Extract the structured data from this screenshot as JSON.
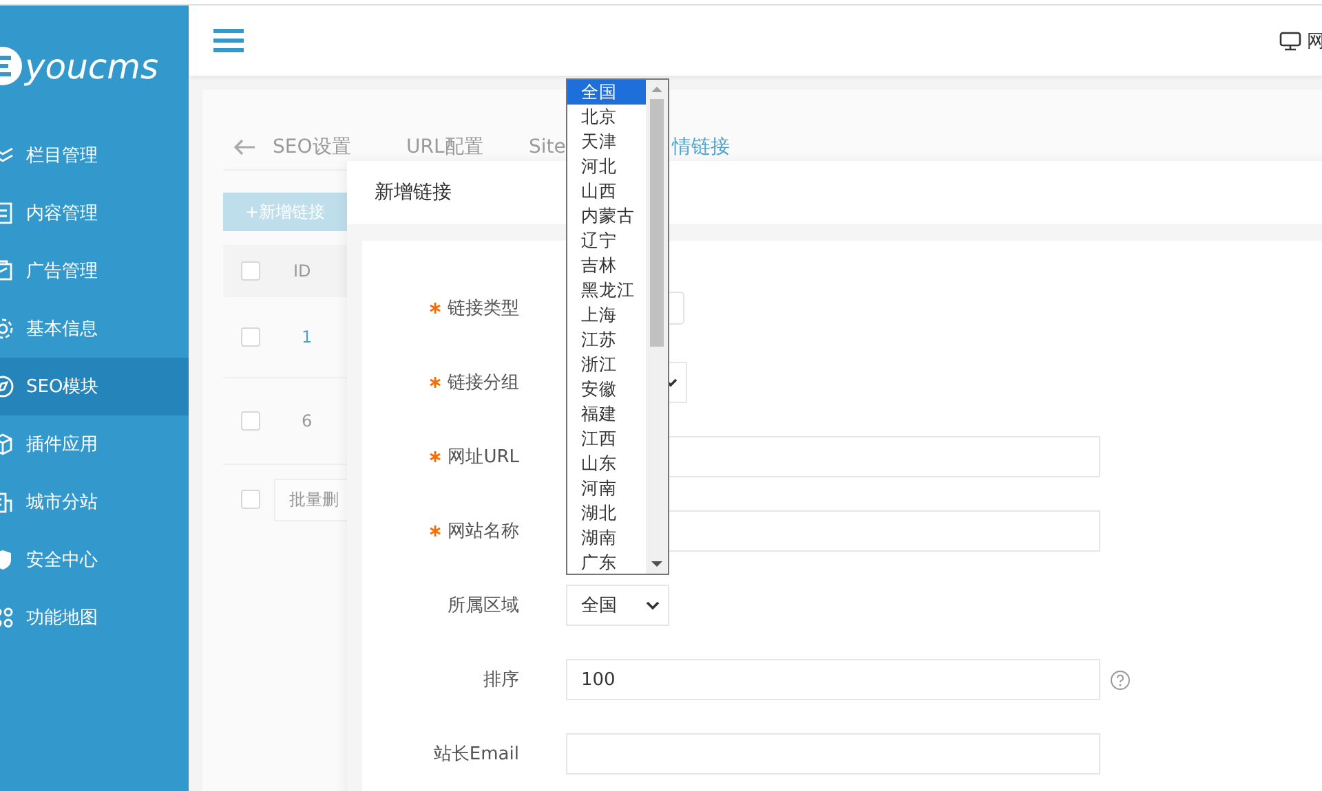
{
  "sidebar": {
    "logo": {
      "text": "youcms"
    },
    "items": [
      {
        "label": "栏目管理",
        "selected": false
      },
      {
        "label": "内容管理",
        "selected": false
      },
      {
        "label": "广告管理",
        "selected": false
      },
      {
        "label": "基本信息",
        "selected": false
      },
      {
        "label": "SEO模块",
        "selected": true
      },
      {
        "label": "插件应用",
        "selected": false
      },
      {
        "label": "城市分站",
        "selected": false
      },
      {
        "label": "安全中心",
        "selected": false
      },
      {
        "label": "功能地图",
        "selected": false
      }
    ]
  },
  "header": {
    "right_text": "网"
  },
  "tabs": [
    {
      "label": "SEO设置",
      "selected": false
    },
    {
      "label": "URL配置",
      "selected": false
    },
    {
      "label": "Site",
      "selected": false
    },
    {
      "label": "情链接",
      "selected": true
    }
  ],
  "table": {
    "add_button": "+新增链接",
    "header_checked": false,
    "columns": [
      "ID"
    ],
    "rows": [
      {
        "id": "1",
        "checked": false
      },
      {
        "id": "6",
        "checked": false
      }
    ],
    "bulk_checked": false,
    "bulk_button": "批量删"
  },
  "modal": {
    "title": "新增链接",
    "fields": [
      {
        "label": "链接类型",
        "required": true,
        "kind": "box"
      },
      {
        "label": "链接分组",
        "required": true,
        "kind": "select"
      },
      {
        "label": "网址URL",
        "required": true,
        "kind": "input"
      },
      {
        "label": "网站名称",
        "required": true,
        "kind": "input"
      },
      {
        "label": "所属区域",
        "required": false,
        "kind": "select",
        "value": "全国"
      },
      {
        "label": "排序",
        "required": false,
        "kind": "input",
        "value": "100",
        "help": true
      },
      {
        "label": "站长Email",
        "required": false,
        "kind": "input"
      }
    ]
  },
  "dropdown": {
    "options": [
      {
        "label": "全国",
        "selected": true
      },
      {
        "label": "北京",
        "selected": false
      },
      {
        "label": "天津",
        "selected": false
      },
      {
        "label": "河北",
        "selected": false
      },
      {
        "label": "山西",
        "selected": false
      },
      {
        "label": "内蒙古",
        "selected": false
      },
      {
        "label": "辽宁",
        "selected": false
      },
      {
        "label": "吉林",
        "selected": false
      },
      {
        "label": "黑龙江",
        "selected": false
      },
      {
        "label": "上海",
        "selected": false
      },
      {
        "label": "江苏",
        "selected": false
      },
      {
        "label": "浙江",
        "selected": false
      },
      {
        "label": "安徽",
        "selected": false
      },
      {
        "label": "福建",
        "selected": false
      },
      {
        "label": "江西",
        "selected": false
      },
      {
        "label": "山东",
        "selected": false
      },
      {
        "label": "河南",
        "selected": false
      },
      {
        "label": "湖北",
        "selected": false
      },
      {
        "label": "湖南",
        "selected": false
      },
      {
        "label": "广东",
        "selected": false
      }
    ]
  }
}
